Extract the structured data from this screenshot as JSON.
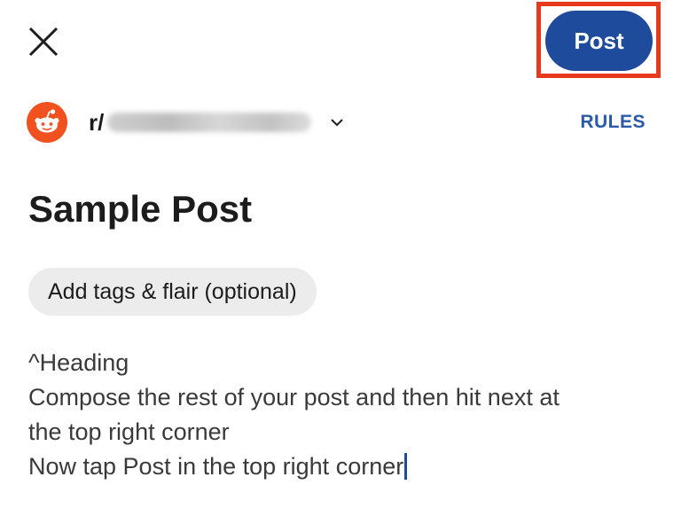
{
  "header": {
    "close_icon": "close-icon",
    "post_label": "Post",
    "post_color": "#1f4b9d",
    "highlight_color": "#e8381d"
  },
  "community": {
    "prefix": "r/",
    "avatar_icon": "reddit-snoo-icon",
    "avatar_color": "#f0511f",
    "dropdown_icon": "chevron-down-icon",
    "rules_label": "RULES"
  },
  "post": {
    "title": "Sample Post",
    "flair_label": "Add tags & flair (optional)",
    "body_lines": [
      "^Heading",
      "Compose the rest of your post and then hit next at",
      "the top right corner",
      "Now tap Post in the top right corner"
    ]
  }
}
